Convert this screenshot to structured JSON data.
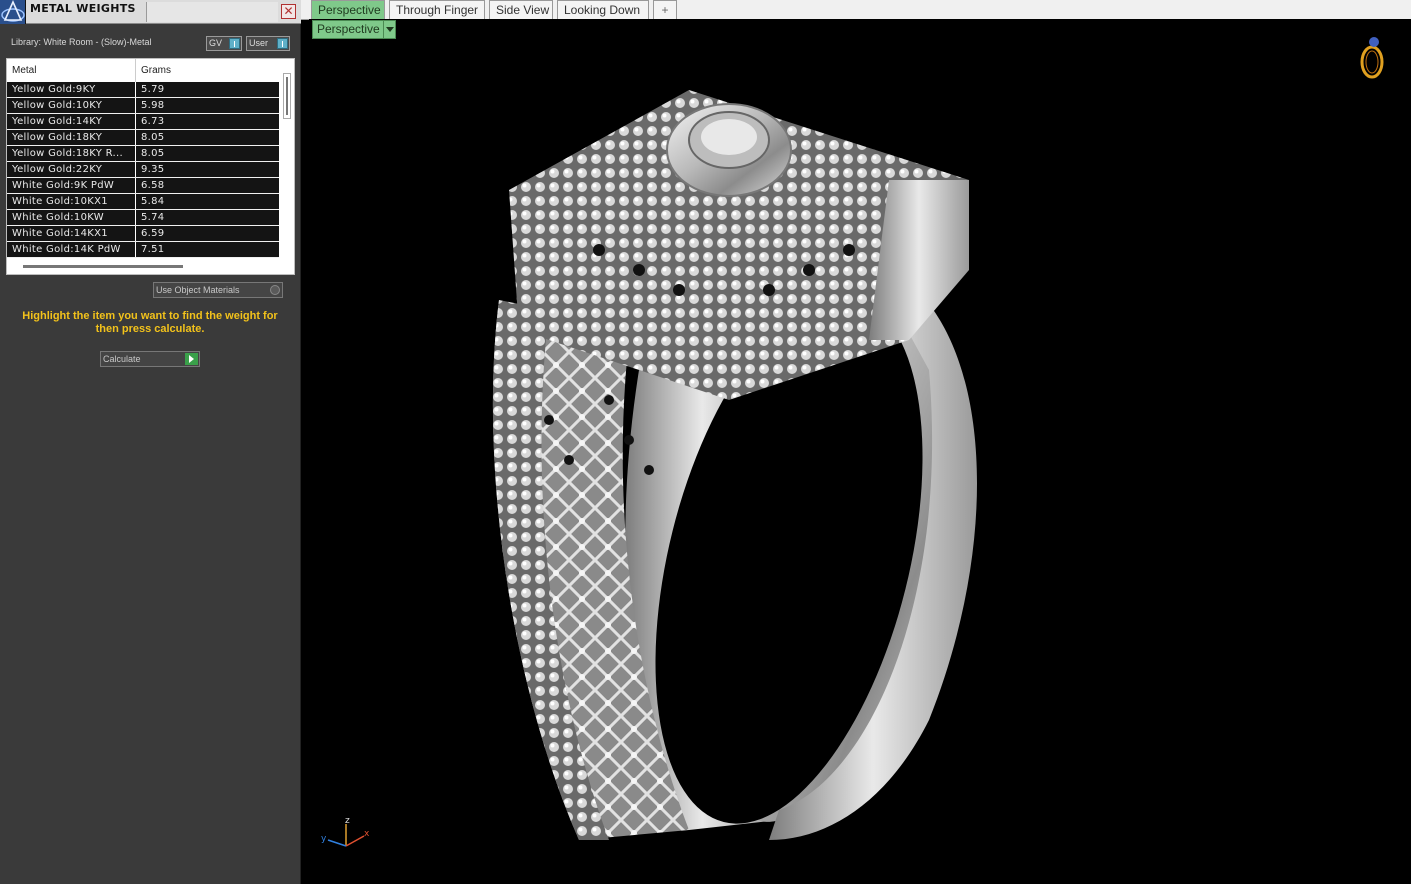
{
  "panel": {
    "title": "METAL WEIGHTS",
    "close_label": "✕",
    "library_label": "Library: White Room - (Slow)-Metal",
    "toggle_gv": "GV",
    "toggle_user": "User",
    "table": {
      "headers": [
        "Metal",
        "Grams"
      ],
      "rows": [
        {
          "metal": "Yellow Gold:9KY",
          "grams": "5.79"
        },
        {
          "metal": "Yellow Gold:10KY",
          "grams": "5.98"
        },
        {
          "metal": "Yellow Gold:14KY",
          "grams": "6.73"
        },
        {
          "metal": "Yellow Gold:18KY",
          "grams": "8.05"
        },
        {
          "metal": "Yellow Gold:18KY R...",
          "grams": "8.05"
        },
        {
          "metal": "Yellow Gold:22KY",
          "grams": "9.35"
        },
        {
          "metal": "White Gold:9K PdW",
          "grams": "6.58"
        },
        {
          "metal": "White Gold:10KX1",
          "grams": "5.84"
        },
        {
          "metal": "White Gold:10KW",
          "grams": "5.74"
        },
        {
          "metal": "White Gold:14KX1",
          "grams": "6.59"
        },
        {
          "metal": "White Gold:14K PdW",
          "grams": "7.51"
        }
      ]
    },
    "use_object_materials": "Use Object Materials",
    "hint": "Highlight the item you want to find the weight for then press calculate.",
    "calculate_label": "Calculate"
  },
  "viewport": {
    "tabs": [
      {
        "label": "Perspective",
        "active": true
      },
      {
        "label": "Through Finger",
        "active": false
      },
      {
        "label": "Side View",
        "active": false
      },
      {
        "label": "Looking Down",
        "active": false
      }
    ],
    "add_tab_label": "+",
    "view_dropdown": "Perspective",
    "axis_labels": {
      "x": "x",
      "y": "y",
      "z": "z"
    }
  },
  "colors": {
    "panel_bg": "#3a3a3a",
    "hint_yellow": "#f2c21b",
    "active_tab": "#7fc98a",
    "viewport_bg": "#000000"
  }
}
